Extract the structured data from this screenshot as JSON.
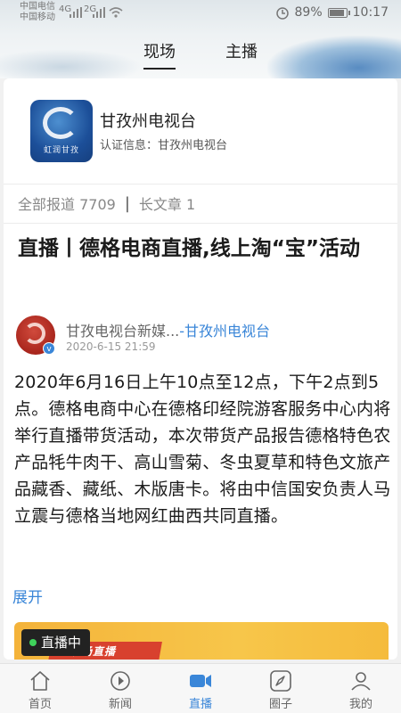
{
  "status_bar": {
    "carrier1": "中国电信",
    "carrier2": "中国移动",
    "net1": "4G",
    "net2": "2G",
    "battery": "89%",
    "time": "10:17"
  },
  "top_tabs": [
    {
      "label": "现场",
      "active": true
    },
    {
      "label": "主播",
      "active": false
    }
  ],
  "channel": {
    "logo_text": "虹润甘孜",
    "name": "甘孜州电视台",
    "cert_label": "认证信息：",
    "cert_value": "甘孜州电视台"
  },
  "stats": {
    "total_label": "全部报道",
    "total_count": "7709",
    "long_label": "长文章",
    "long_count": "1"
  },
  "article": {
    "headline": "直播丨德格电商直播,线上淘“宝”活动",
    "author_name": "甘孜电视台新媒...",
    "author_org": "-甘孜州电视台",
    "date": "2020-6-15 21:59",
    "body": "2020年6月16日上午10点至12点，下午2点到5点。德格电商中心在德格印经院游客服务中心内将举行直播带货活动，本次带货产品报告德格特色农产品牦牛肉干、高山雪菊、冬虫夏草和特色文旅产品藏香、藏纸、木版唐卡。将由中信国安负责人马立震与德格当地网红曲西共同直播。",
    "expand_label": "展开"
  },
  "live": {
    "badge": "直播中",
    "banner_text": "现场直播"
  },
  "bottom_nav": [
    {
      "label": "首页",
      "icon": "home-icon",
      "active": false
    },
    {
      "label": "新闻",
      "icon": "play-icon",
      "active": false
    },
    {
      "label": "直播",
      "icon": "video-camera-icon",
      "active": true
    },
    {
      "label": "圈子",
      "icon": "compass-icon",
      "active": false
    },
    {
      "label": "我的",
      "icon": "profile-icon",
      "active": false
    }
  ],
  "colors": {
    "accent": "#3a86d8",
    "live_dot": "#3fd25b",
    "banner_yellow": "#f5bb3c",
    "banner_red": "#d8412e"
  }
}
